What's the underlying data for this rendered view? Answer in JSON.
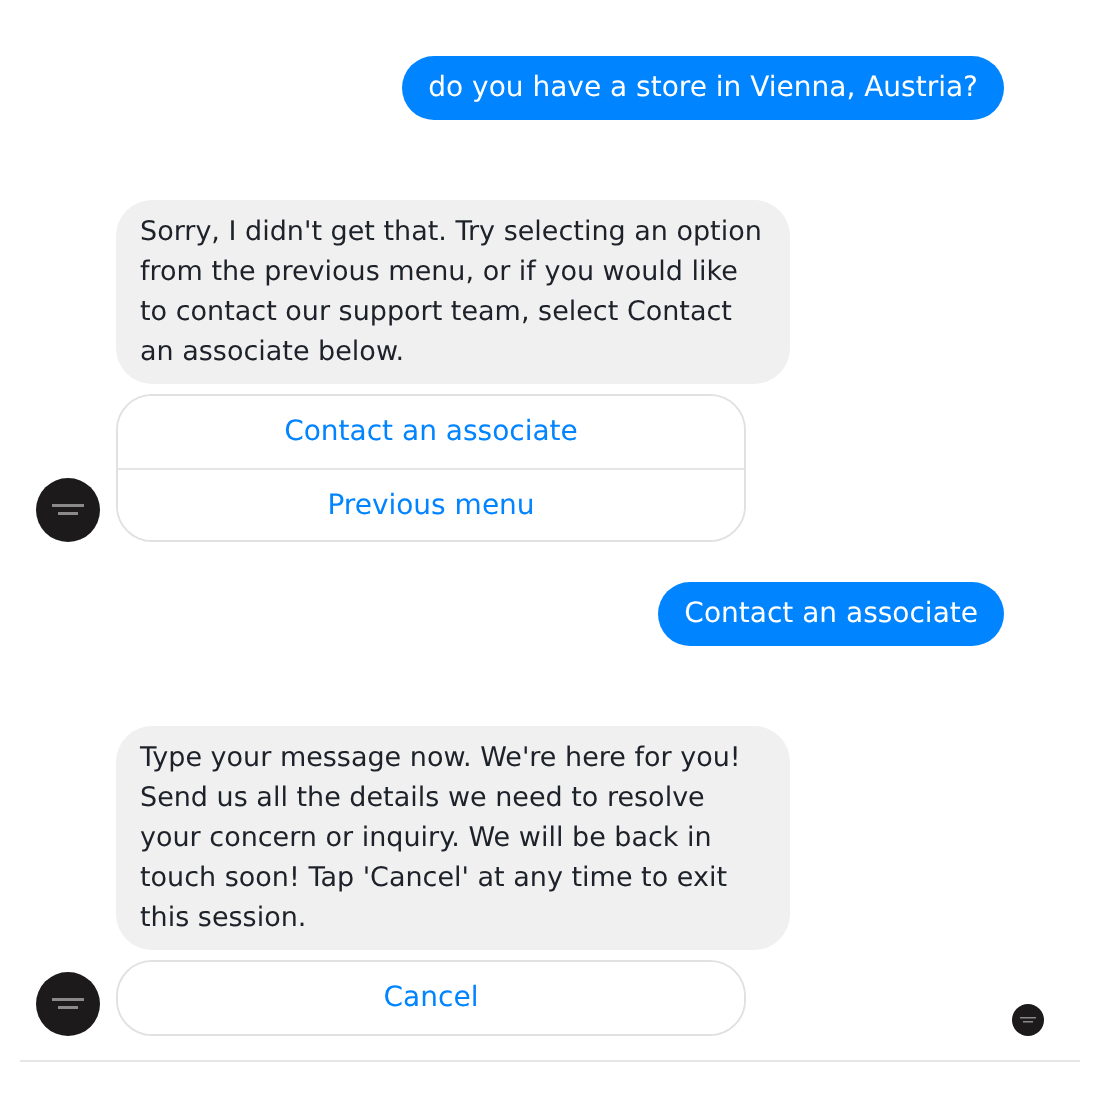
{
  "messages": [
    {
      "kind": "user",
      "text": "do you have a store in Vienna, Austria?"
    },
    {
      "kind": "bot",
      "text": "Sorry, I didn't get that. Try selecting an option from the previous menu, or if you would like to contact our support team, select Contact an associate below.",
      "buttons": [
        "Contact an associate",
        "Previous menu"
      ]
    },
    {
      "kind": "user",
      "text": "Contact an associate"
    },
    {
      "kind": "bot",
      "text": "Type your message now. We're here for you! Send us all the details we need to resolve your concern or inquiry. We will be back in touch soon! Tap 'Cancel' at any time to exit this session.",
      "buttons": [
        "Cancel"
      ],
      "seen": true
    }
  ]
}
